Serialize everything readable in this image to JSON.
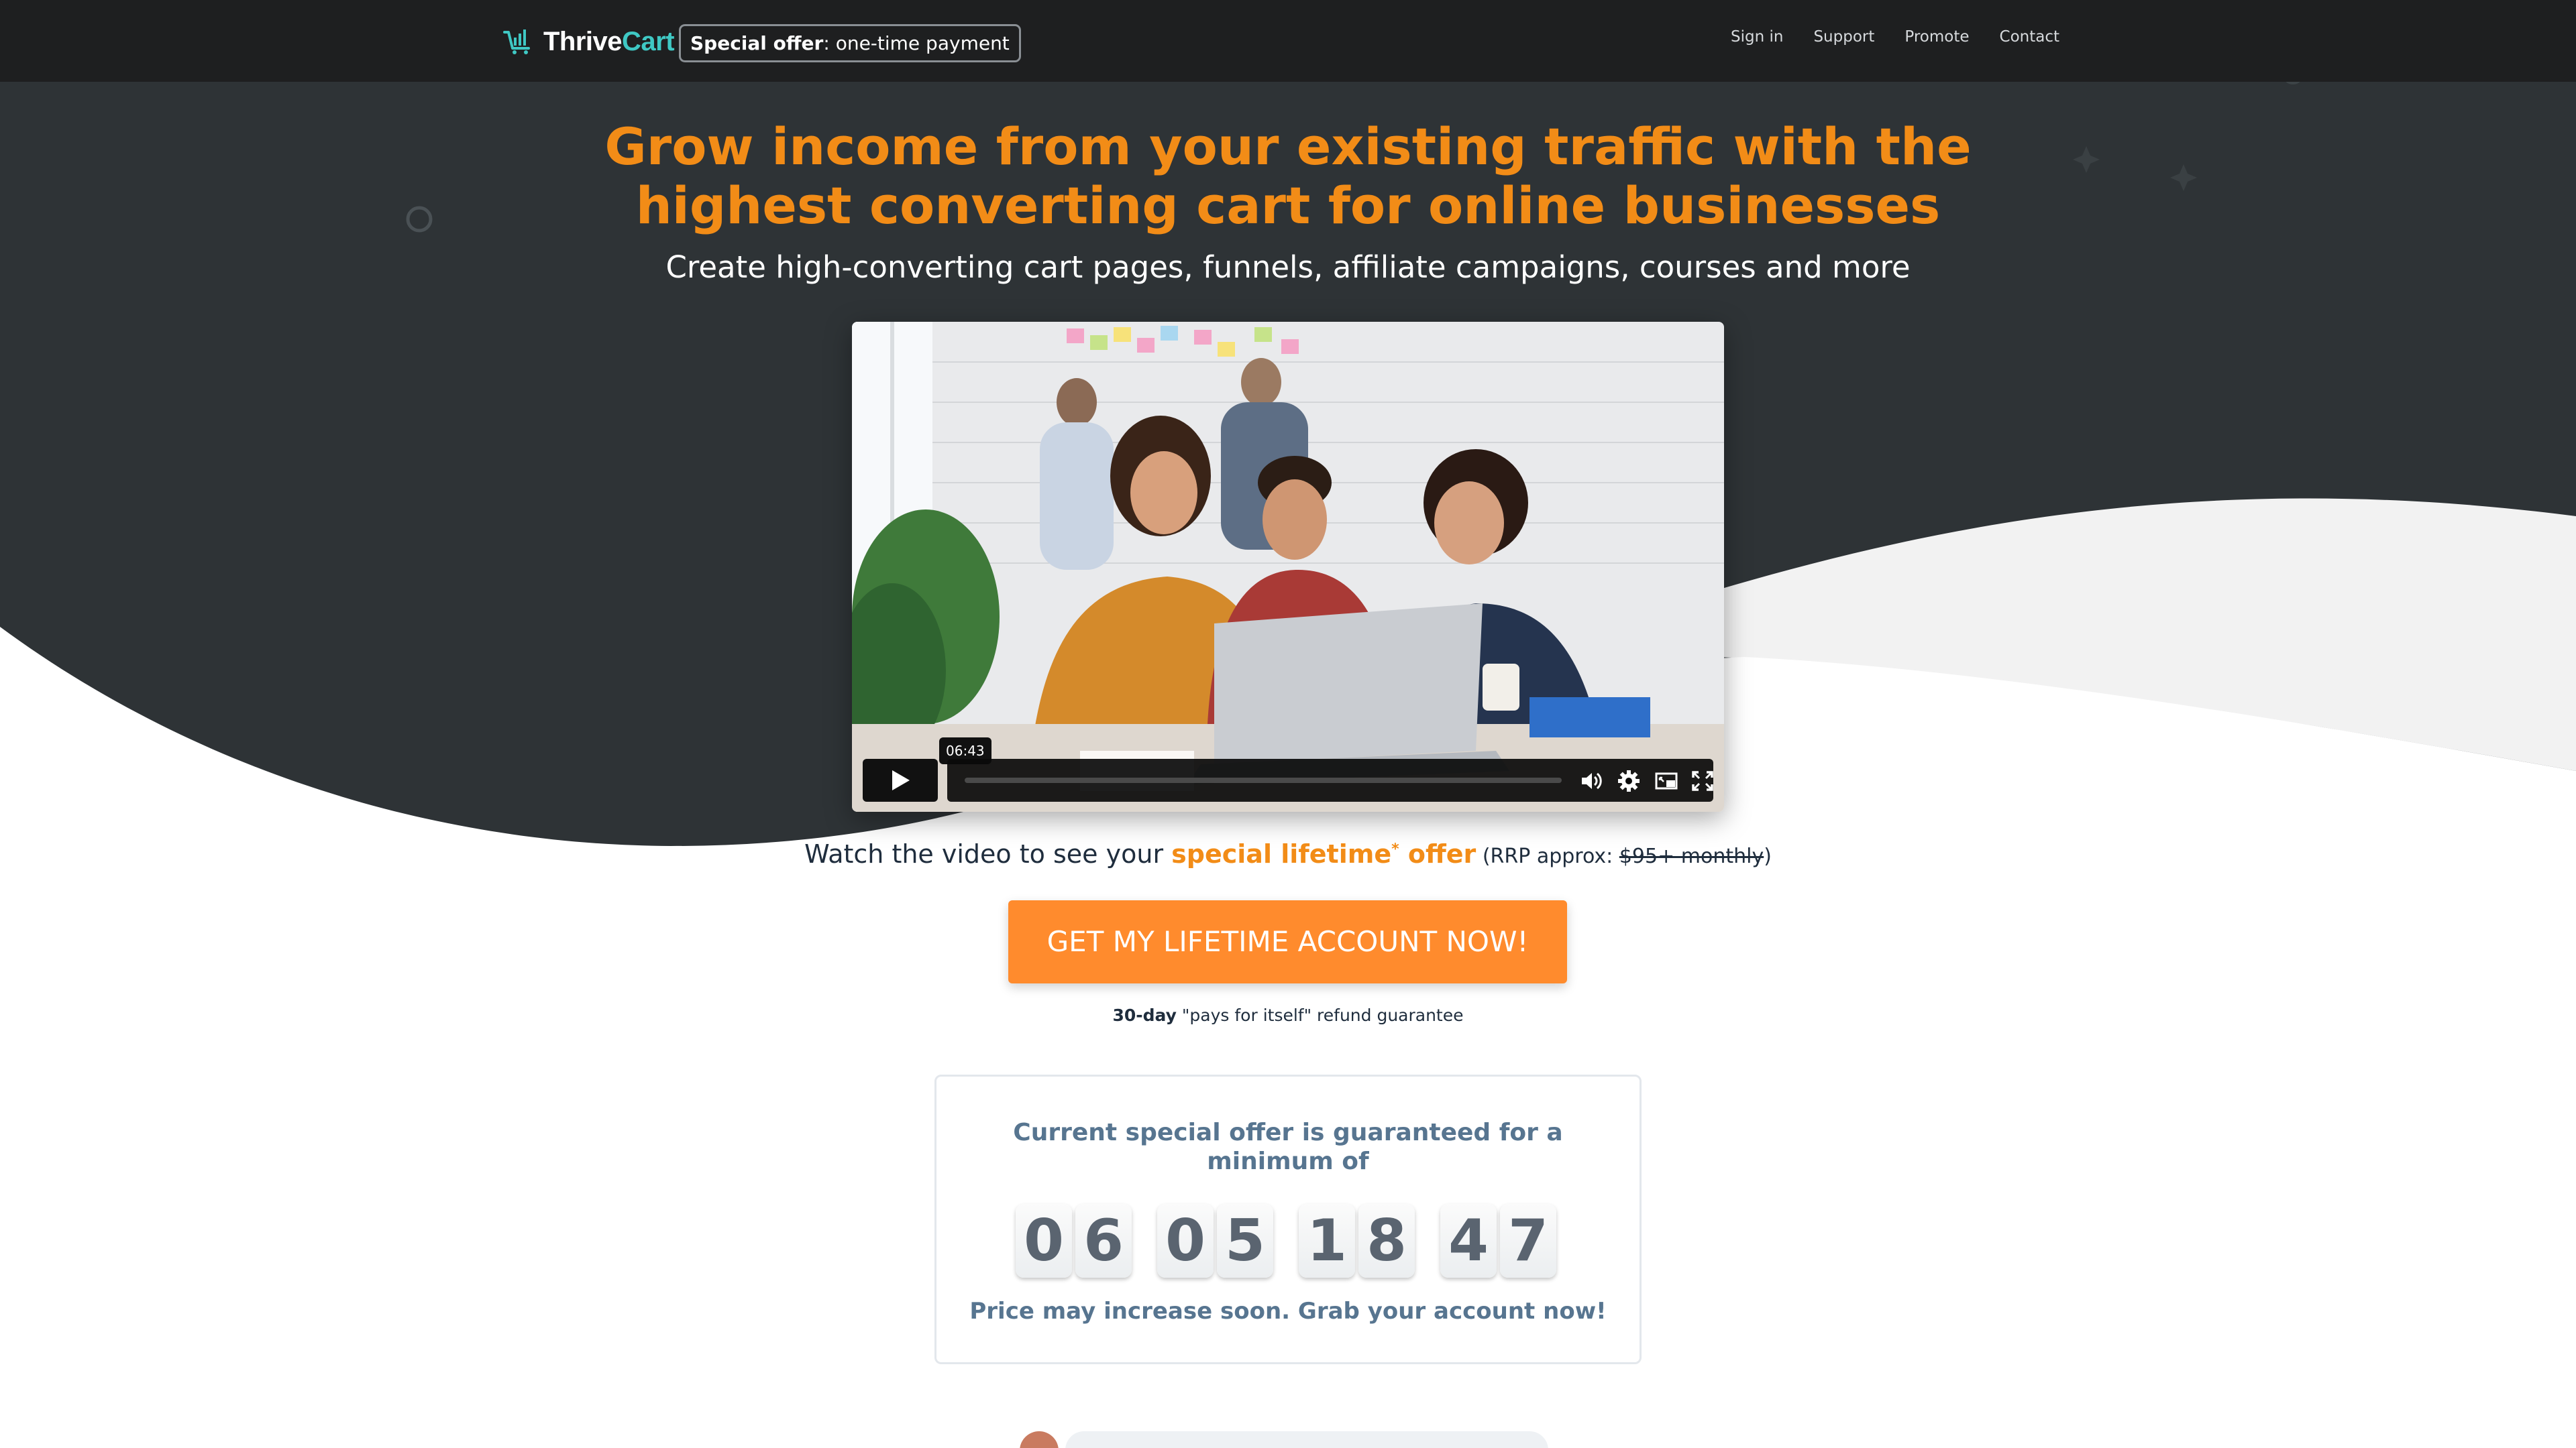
{
  "nav": {
    "logo_first": "Thrive",
    "logo_second": "Cart",
    "badge_bold": "Special offer",
    "badge_rest": ": one-time payment",
    "links": [
      "Sign in",
      "Support",
      "Promote",
      "Contact"
    ]
  },
  "hero": {
    "headline_line1": "Grow income from your existing traffic with the",
    "headline_line2": "highest converting cart for online businesses",
    "subheadline": "Create high-converting cart pages, funnels, affiliate campaigns, courses and more"
  },
  "video": {
    "time": "06:43",
    "icons": [
      "play-icon",
      "volume-icon",
      "settings-icon",
      "picture-in-picture-icon",
      "fullscreen-icon"
    ]
  },
  "pitch": {
    "watch_prefix": "Watch the video to see your ",
    "watch_highlight": "special lifetime",
    "watch_star": "*",
    "watch_offer": " offer",
    "rrp_prefix": " (RRP approx: ",
    "rrp_price": "$95+ monthly",
    "rrp_suffix": ")",
    "cta": "GET MY LIFETIME ACCOUNT NOW!",
    "guarantee_bold": "30-day",
    "guarantee_rest": " \"pays for itself\" refund guarantee"
  },
  "countdown": {
    "title": "Current special offer is guaranteed for a minimum of",
    "digits": [
      "0",
      "6",
      "0",
      "5",
      "1",
      "8",
      "4",
      "7"
    ],
    "footer": "Price may increase soon. Grab your account now!"
  },
  "colors": {
    "accent_orange": "#f28c17",
    "cta_orange": "#ff8b2d",
    "hero_dark": "#2e3336",
    "nav_dark": "#1e1f20",
    "teal": "#3fc8c4",
    "slate_text": "#577590"
  }
}
